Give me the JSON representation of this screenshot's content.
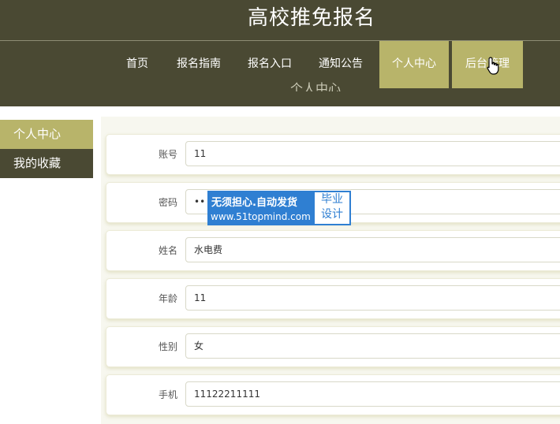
{
  "header": {
    "site_title": "高校推免报名"
  },
  "nav": {
    "items": [
      {
        "label": "首页"
      },
      {
        "label": "报名指南"
      },
      {
        "label": "报名入口"
      },
      {
        "label": "通知公告"
      },
      {
        "label": "个人中心"
      },
      {
        "label": "后台管理"
      }
    ]
  },
  "page": {
    "heading": "个人中心"
  },
  "sidebar": {
    "items": [
      {
        "label": "个人中心"
      },
      {
        "label": "我的收藏"
      }
    ]
  },
  "form": {
    "fields": [
      {
        "label": "账号",
        "value": "11"
      },
      {
        "label": "密码",
        "value": "••"
      },
      {
        "label": "姓名",
        "value": "水电费"
      },
      {
        "label": "年龄",
        "value": "11"
      },
      {
        "label": "性别",
        "value": "女"
      },
      {
        "label": "手机",
        "value": "11122211111"
      }
    ]
  },
  "watermark": {
    "line1": "无须担心.自动发货",
    "line2": "www.51topmind.com",
    "badge_line1": "毕业",
    "badge_line2": "设计"
  },
  "colors": {
    "header_bg": "#4a4933",
    "accent": "#b8b46a",
    "watermark_blue": "#2f7fd2"
  }
}
